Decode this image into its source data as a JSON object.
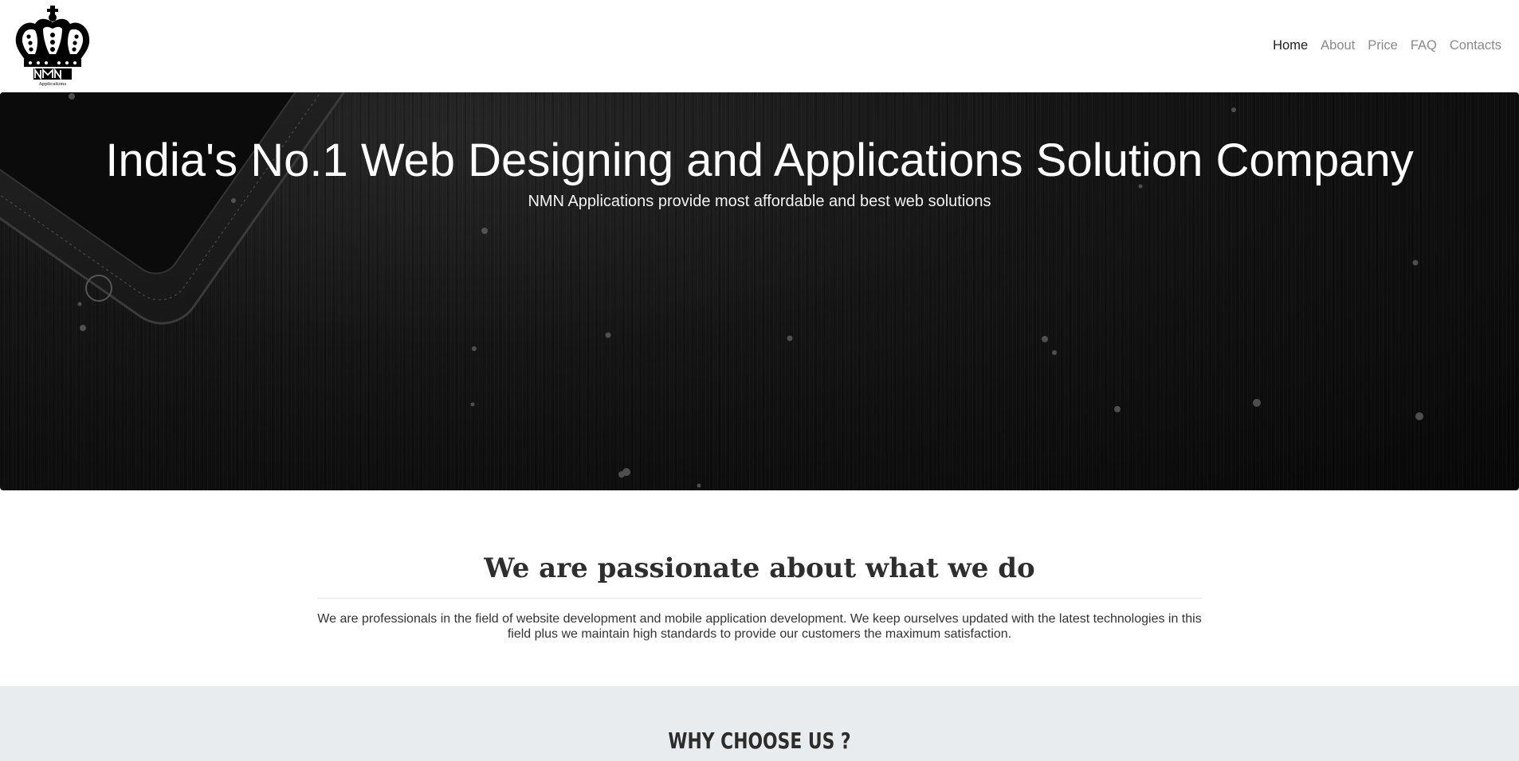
{
  "brand": {
    "logo_icon": "crown-logo-icon",
    "logo_text": "NMN",
    "logo_subtext": "Applications"
  },
  "nav": {
    "items": [
      {
        "label": "Home",
        "active": true
      },
      {
        "label": "About",
        "active": false
      },
      {
        "label": "Price",
        "active": false
      },
      {
        "label": "FAQ",
        "active": false
      },
      {
        "label": "Contacts",
        "active": false
      }
    ]
  },
  "hero": {
    "title": "India's No.1 Web Designing and Applications Solution Company",
    "subtitle": "NMN Applications provide most affordable and best web solutions",
    "background_color": "#0d0d0d"
  },
  "intro": {
    "heading": "We are passionate about what we do",
    "body": "We are professionals in the field of website development and mobile application development. We keep ourselves updated with the latest technologies in this field plus we maintain high standards to provide our customers the maximum satisfaction."
  },
  "why": {
    "heading": "WHY CHOOSE US ?",
    "background_color": "#e9ecef"
  }
}
